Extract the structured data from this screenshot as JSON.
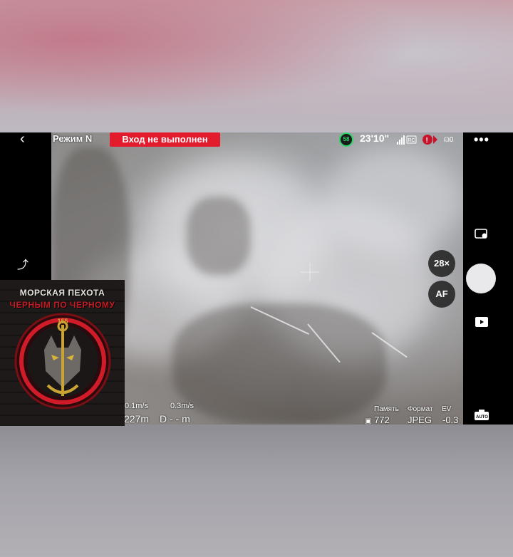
{
  "status": {
    "mode": "Режим N",
    "warning": "Вход не выполнен",
    "battery": "58",
    "flight_time": "23'10\"",
    "obstacle": "0",
    "signal_label": "RC"
  },
  "controls": {
    "zoom": "28×",
    "af": "AF"
  },
  "telemetry": {
    "h_speed": "0.1m/s",
    "v_speed": "0.3m/s",
    "height": "227m",
    "distance": "D - - m"
  },
  "camera": {
    "memory_label": "Память",
    "format_label": "Формат",
    "ev_label": "EV",
    "memory_value": "772",
    "format_value": "JPEG",
    "ev_value": "-0.3"
  },
  "watermark": {
    "line1": "МОРСКАЯ ПЕХОТА",
    "line2": "ЧЕРНЫМ ПО ЧЕРНОМУ",
    "number": "155"
  },
  "colors": {
    "warning_bg": "#e21b2d",
    "battery": "#2fd36a"
  }
}
